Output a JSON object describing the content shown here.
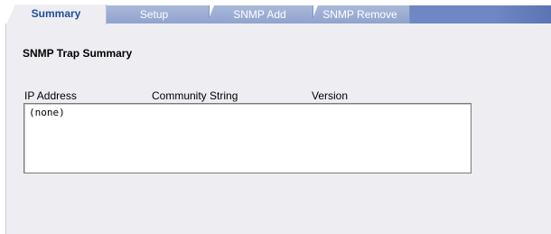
{
  "tabs": [
    {
      "label": "Summary",
      "active": true
    },
    {
      "label": "Setup",
      "active": false
    },
    {
      "label": "SNMP Add",
      "active": false
    },
    {
      "label": "SNMP Remove",
      "active": false
    }
  ],
  "section_title": "SNMP Trap Summary",
  "table": {
    "columns": [
      "IP Address",
      "Community String",
      "Version"
    ],
    "rows": [
      "(none)"
    ]
  },
  "colors": {
    "active_tab_text": "#1c4d9e",
    "inactive_tab_bg": "#8fa3cf",
    "panel_bg": "#eeeef2"
  }
}
